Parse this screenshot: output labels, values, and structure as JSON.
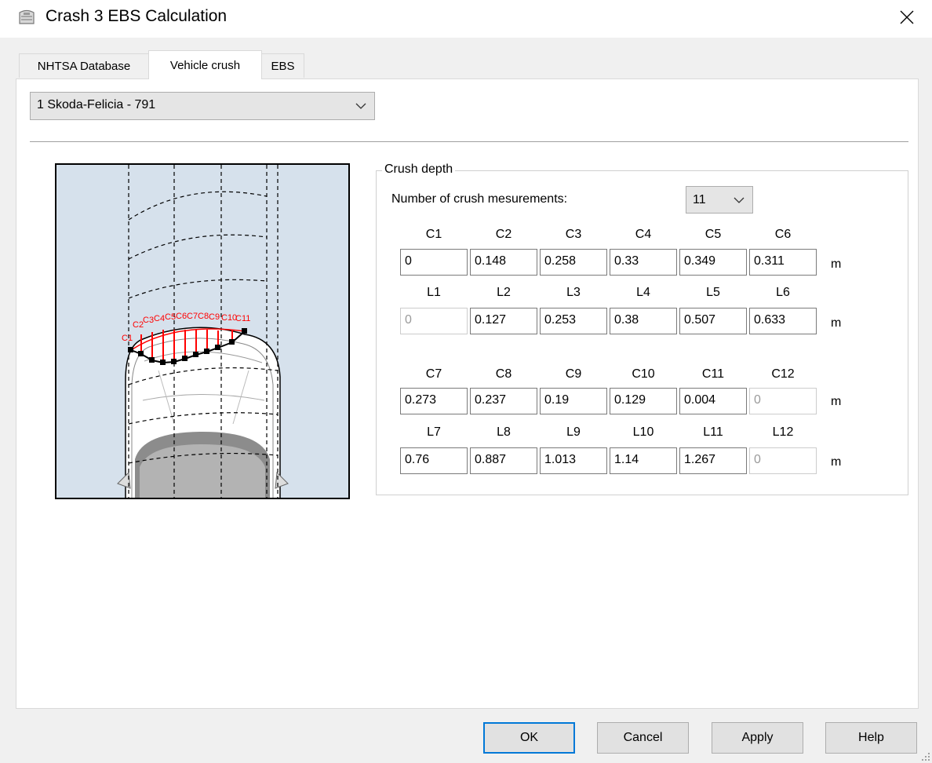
{
  "window": {
    "title": "Crash 3 EBS Calculation",
    "app_icon": "car-seat-icon",
    "close_icon": "close-icon"
  },
  "tabs": [
    {
      "label": "NHTSA Database",
      "active": false
    },
    {
      "label": "Vehicle crush",
      "active": true
    },
    {
      "label": "EBS",
      "active": false
    }
  ],
  "vehicle_select": {
    "value": "1 Skoda-Felicia - 791"
  },
  "diagram": {
    "background": "#d6e1ec",
    "crush_color": "#ff0000",
    "point_labels": [
      "C1",
      "C2",
      "C3",
      "C4",
      "C5",
      "C6",
      "C7",
      "C8",
      "C9",
      "C10",
      "C11"
    ]
  },
  "crush_group": {
    "title": "Crush depth",
    "num_label": "Number of crush mesurements:",
    "num_value": "11",
    "unit": "m",
    "rows": [
      {
        "headers": [
          "C1",
          "C2",
          "C3",
          "C4",
          "C5",
          "C6"
        ],
        "values": [
          "0",
          "0.148",
          "0.258",
          "0.33",
          "0.349",
          "0.311"
        ],
        "disabled": [
          false,
          false,
          false,
          false,
          false,
          false
        ]
      },
      {
        "headers": [
          "L1",
          "L2",
          "L3",
          "L4",
          "L5",
          "L6"
        ],
        "values": [
          "0",
          "0.127",
          "0.253",
          "0.38",
          "0.507",
          "0.633"
        ],
        "disabled": [
          true,
          false,
          false,
          false,
          false,
          false
        ]
      },
      {
        "headers": [
          "C7",
          "C8",
          "C9",
          "C10",
          "C11",
          "C12"
        ],
        "values": [
          "0.273",
          "0.237",
          "0.19",
          "0.129",
          "0.004",
          "0"
        ],
        "disabled": [
          false,
          false,
          false,
          false,
          false,
          true
        ]
      },
      {
        "headers": [
          "L7",
          "L8",
          "L9",
          "L10",
          "L11",
          "L12"
        ],
        "values": [
          "0.76",
          "0.887",
          "1.013",
          "1.14",
          "1.267",
          "0"
        ],
        "disabled": [
          false,
          false,
          false,
          false,
          false,
          true
        ]
      }
    ]
  },
  "buttons": {
    "ok": "OK",
    "cancel": "Cancel",
    "apply": "Apply",
    "help": "Help"
  }
}
